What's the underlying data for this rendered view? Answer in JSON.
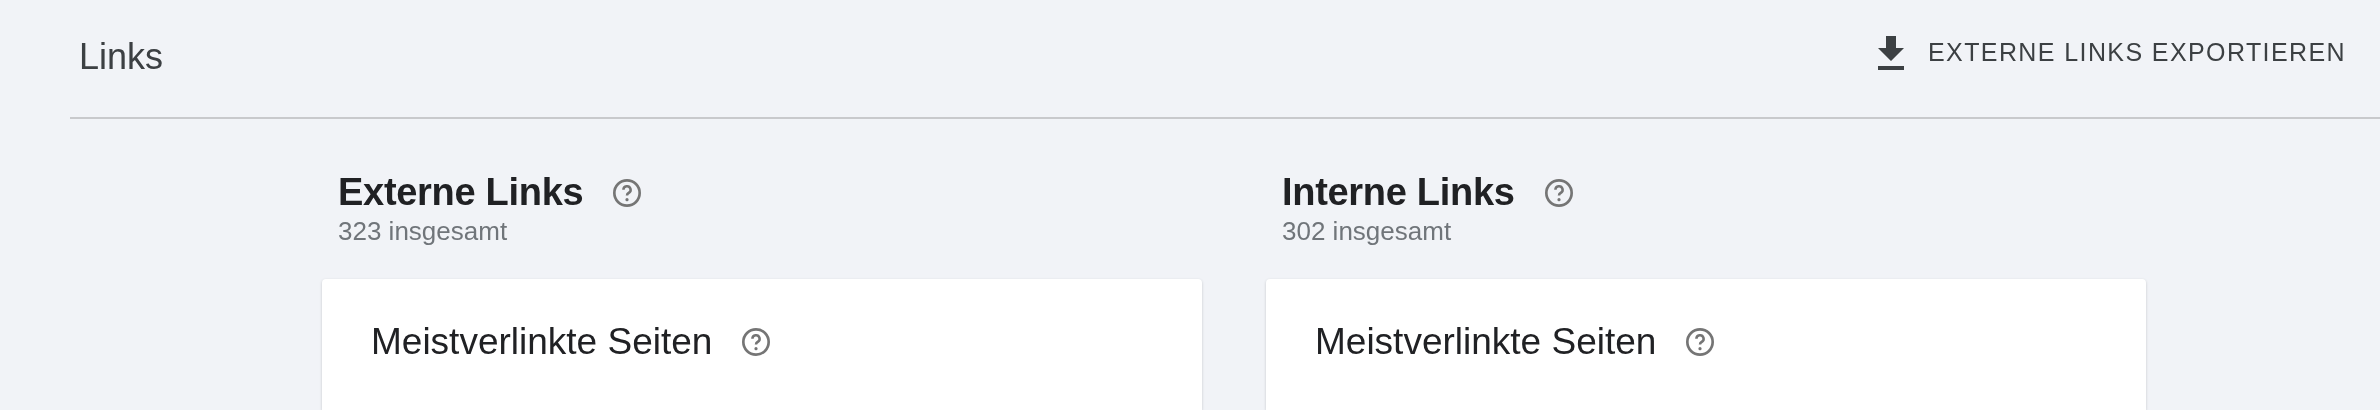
{
  "page_title": "Links",
  "export_button": {
    "label": "EXTERNE LINKS EXPORTIEREN"
  },
  "sections": [
    {
      "title": "Externe Links",
      "total": "323 insgesamt",
      "card": {
        "title": "Meistverlinkte Seiten"
      }
    },
    {
      "title": "Interne Links",
      "total": "302 insgesamt",
      "card": {
        "title": "Meistverlinkte Seiten"
      }
    }
  ]
}
